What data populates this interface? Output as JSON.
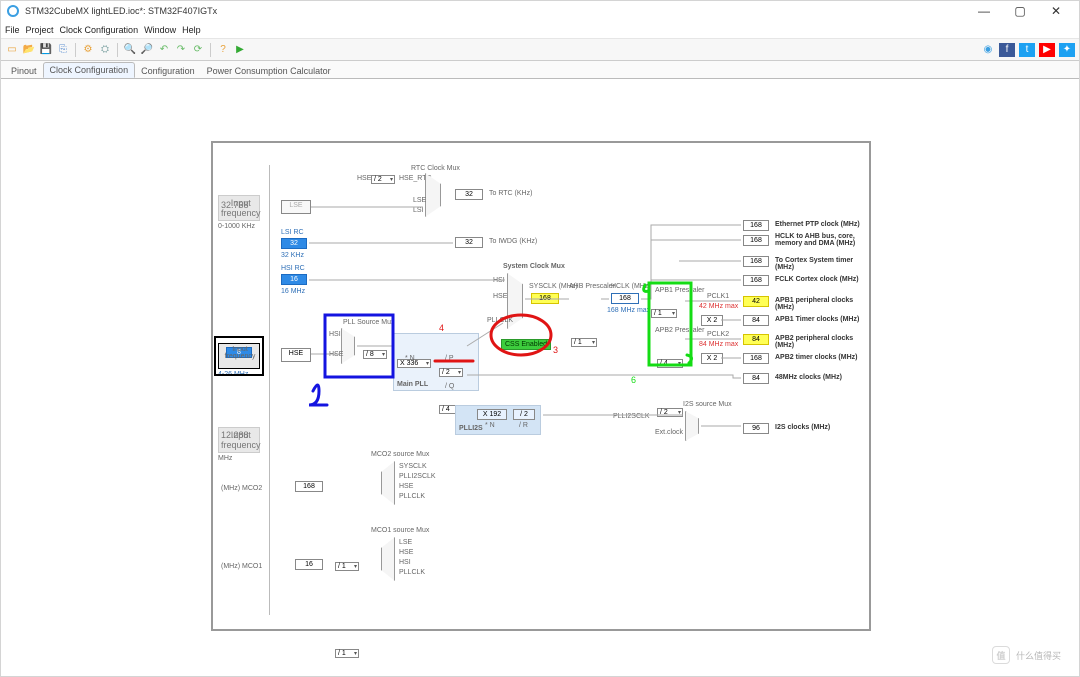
{
  "window": {
    "title": "STM32CubeMX lightLED.ioc*: STM32F407IGTx"
  },
  "menu": {
    "file": "File",
    "project": "Project",
    "clock": "Clock Configuration",
    "window": "Window",
    "help": "Help"
  },
  "tabs": {
    "pinout": "Pinout",
    "clock": "Clock Configuration",
    "config": "Configuration",
    "power": "Power Consumption Calculator"
  },
  "side": {
    "in1_lbl": "Input frequency",
    "in1_val": "32.768",
    "in1_unit": "0-1000 KHz",
    "in2_lbl": "Input frequency",
    "in2_val": "8",
    "in2_unit": "4-26 MHz",
    "in3_lbl": "Input frequency",
    "in3_val": "12.288",
    "in3_unit": "MHz",
    "mco2_lbl": "(MHz) MCO2",
    "mco1_lbl": "(MHz) MCO1"
  },
  "blk": {
    "lse": "LSE",
    "hse": "HSE",
    "lsi_lbl": "LSI RC",
    "lsi_val": "32",
    "lsi_mhz": "32 KHz",
    "hsi_lbl": "HSI RC",
    "hsi_val": "16",
    "hsi_mhz": "16 MHz",
    "rtc_mux": "RTC Clock Mux",
    "rtc_div": "/ 2",
    "rtc_hse": "HSE",
    "rtc_hsertc": "HSE_RTC",
    "rtc_lse": "LSE",
    "rtc_lsi": "LSI",
    "rtc_val": "32",
    "rtc_to": "To RTC (KHz)",
    "iwdg_val": "32",
    "iwdg_to": "To IWDG (KHz)",
    "pllsrc": "PLL Source Mux",
    "pllsrc_hsi": "HSI",
    "pllsrc_hse": "HSE",
    "pllm": "/ 8",
    "plln": "X 336",
    "plln_sub": "* N",
    "pllp": "/ 2",
    "pllp_sub": "/ P",
    "pllq": "/ 4",
    "pllq_sub": "/ Q",
    "mainpll": "Main PLL",
    "pllis": "PLLI2S",
    "pllisn": "X 192",
    "pllisn_sub": "* N",
    "pllisr": "/ 2",
    "pllisr_sub": "/ R",
    "sysmux": "System Clock Mux",
    "sysmux_hsi": "HSI",
    "sysmux_hse": "HSE",
    "sysmux_pll": "PLLCLK",
    "sysclk_lbl": "SYSCLK (MHz)",
    "sysclk": "168",
    "css": "CSS Enabled",
    "ahb_lbl": "AHB Prescaler",
    "ahb": "/ 1",
    "hclk_lbl": "HCLK (MHz)",
    "hclk": "168",
    "hclk_max": "168 MHz max",
    "apb1_lbl": "APB1 Prescaler",
    "apb1": "/ 4",
    "pclk1_lbl": "PCLK1",
    "pclk1_max": "42 MHz max",
    "apb1_x": "X 2",
    "apb2_lbl": "APB2 Prescaler",
    "apb2": "/ 2",
    "pclk2_lbl": "PCLK2",
    "pclk2_max": "84 MHz max",
    "apb2_x": "X 2",
    "cortdiv": "/ 1",
    "i2smux": "I2S source Mux",
    "i2s_pll": "PLLI2SCLK",
    "i2s_ext": "Ext.clock",
    "mco2_mux": "MCO2 source Mux",
    "mco2_sysclk": "SYSCLK",
    "mco2_plli2s": "PLLI2SCLK",
    "mco2_hse": "HSE",
    "mco2_pll": "PLLCLK",
    "mco2_val": "168",
    "mco2_div": "/ 1",
    "mco1_mux": "MCO1 source Mux",
    "mco1_lse": "LSE",
    "mco1_hse": "HSE",
    "mco1_hsi": "HSI",
    "mco1_pll": "PLLCLK",
    "mco1_val": "16",
    "mco1_div": "/ 1"
  },
  "out": {
    "ptp_val": "168",
    "ptp": "Ethernet PTP clock (MHz)",
    "ahbbus_val": "168",
    "ahbbus": "HCLK to AHB bus, core, memory and DMA (MHz)",
    "cortimer_val": "168",
    "cortimer": "To Cortex System timer (MHz)",
    "fclk_val": "168",
    "fclk": "FCLK Cortex clock (MHz)",
    "apb1p_val": "42",
    "apb1p": "APB1 peripheral clocks (MHz)",
    "apb1t_val": "84",
    "apb1t": "APB1 Timer clocks (MHz)",
    "apb2p_val": "84",
    "apb2p": "APB2 peripheral clocks (MHz)",
    "apb2t_val": "168",
    "apb2t": "APB2 timer clocks (MHz)",
    "m48_val": "84",
    "m48": "48MHz clocks (MHz)",
    "i2s_val": "96",
    "i2s": "I2S clocks (MHz)"
  },
  "ann": {
    "n1": "1",
    "n2": "2",
    "n3": "3",
    "n4": "4",
    "n5": "5",
    "n6": "6"
  },
  "watermark": "什么值得买"
}
